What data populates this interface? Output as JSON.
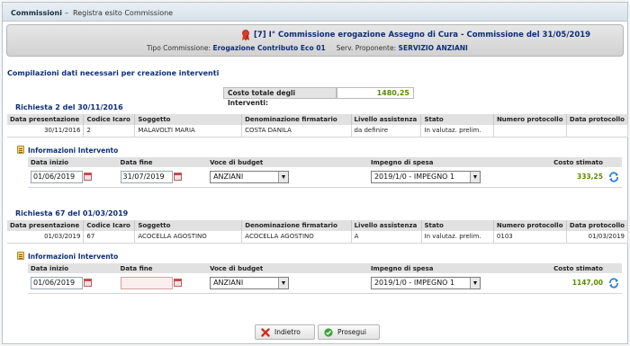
{
  "breadcrumb": {
    "main": "Commissioni",
    "separator": "–",
    "sub": "Registra esito Commissione"
  },
  "header": {
    "title": "[7] I° Commissione erogazione Assegno di Cura - Commissione del 31/05/2019",
    "tipo_label": "Tipo Commissione:",
    "tipo_value": "Erogazione Contributo Eco 01",
    "serv_label": "Serv. Proponente:",
    "serv_value": "SERVIZIO ANZIANI"
  },
  "section_title": "Compilazioni dati necessari per creazione interventi",
  "costo_totale": {
    "label": "Costo totale degli Interventi:",
    "value": "1480,25"
  },
  "requests_columns": [
    "Data presentazione",
    "Codice Icaro",
    "Soggetto",
    "Denominazione firmatario",
    "Livello assistenza",
    "Stato",
    "Numero protocollo",
    "Data protocollo"
  ],
  "intervento_columns": [
    "Data inizio",
    "Data fine",
    "Voce di budget",
    "Impegno di spesa",
    "Costo stimato"
  ],
  "info_title": "Informazioni Intervento",
  "requests": [
    {
      "title": "Richiesta 2 del 30/11/2016",
      "row": [
        "30/11/2016",
        "2",
        "MALAVOLTI MARIA",
        "COSTA DANILA",
        "da definire",
        "In valutaz. prelim.",
        "",
        ""
      ],
      "intervento": {
        "data_inizio": "01/06/2019",
        "data_fine": "31/07/2019",
        "voce": "ANZIANI",
        "impegno": "2019/1/0 - IMPEGNO 1",
        "costo": "333,25"
      }
    },
    {
      "title": "Richiesta 67 del 01/03/2019",
      "row": [
        "01/03/2019",
        "67",
        "ACOCELLA AGOSTINO",
        "ACOCELLA AGOSTINO",
        "A",
        "In valutaz. prelim.",
        "0103",
        "01/03/2019"
      ],
      "intervento": {
        "data_inizio": "01/06/2019",
        "data_fine": "",
        "voce": "ANZIANI",
        "impegno": "2019/1/0 - IMPEGNO 1",
        "costo": "1147,00"
      }
    }
  ],
  "buttons": {
    "back": "Indietro",
    "next": "Prosegui"
  },
  "icons": [
    "ribbon-icon",
    "notes-icon",
    "calendar-icon",
    "refresh-icon",
    "cancel-icon",
    "check-icon"
  ],
  "colors": {
    "accent_blue": "#0d2e78",
    "cost_green": "#5b8a00",
    "header_bg": "#d7e2ea"
  }
}
